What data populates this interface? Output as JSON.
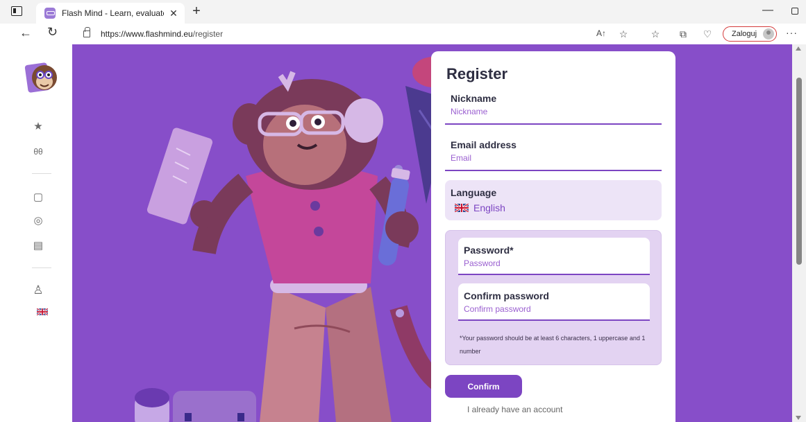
{
  "browser": {
    "tab_title": "Flash Mind - Learn, evaluate and",
    "url_host": "https://www.flashmind.eu",
    "url_path": "/register",
    "login_label": "Zaloguj",
    "read_aloud_label": "A↑",
    "icons": [
      "back-icon",
      "reload-icon",
      "lock-icon",
      "read-aloud-icon",
      "favorite-star-icon",
      "favorites-list-icon",
      "collections-icon",
      "performance-icon",
      "more-icon"
    ]
  },
  "sidebar": {
    "items": [
      {
        "name": "favorites",
        "icon": "star-icon",
        "glyph": "★"
      },
      {
        "name": "explore",
        "icon": "binoculars-icon",
        "glyph": "θθ"
      },
      {
        "name": "documents",
        "icon": "document-icon",
        "glyph": "▢"
      },
      {
        "name": "help",
        "icon": "lifebuoy-icon",
        "glyph": "◎"
      },
      {
        "name": "library",
        "icon": "book-icon",
        "glyph": "▤"
      },
      {
        "name": "account",
        "icon": "user-icon",
        "glyph": "♙"
      },
      {
        "name": "language",
        "icon": "uk-flag-icon",
        "glyph": ""
      }
    ]
  },
  "register": {
    "title": "Register",
    "nickname": {
      "label": "Nickname",
      "placeholder": "Nickname",
      "value": ""
    },
    "email": {
      "label": "Email address",
      "placeholder": "Email",
      "value": ""
    },
    "language": {
      "label": "Language",
      "value": "English",
      "flag": "uk-flag-icon"
    },
    "password": {
      "label": "Password*",
      "placeholder": "Password",
      "value": ""
    },
    "confirm_password": {
      "label": "Confirm password",
      "placeholder": "Confirm password",
      "value": ""
    },
    "password_hint": "*Your password should be at least 6 characters, 1 uppercase and 1 number",
    "confirm_label": "Confirm",
    "account_link": "I already have an account"
  },
  "colors": {
    "hero_background": "#874ec9",
    "accent": "#7c45c2",
    "password_box": "#e3d3f2",
    "language_box": "#ede4f7"
  }
}
